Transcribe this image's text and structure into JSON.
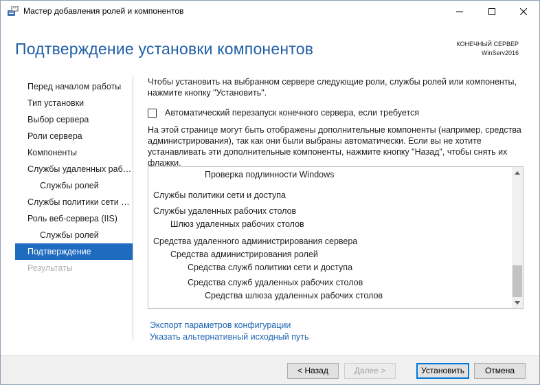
{
  "window": {
    "title": "Мастер добавления ролей и компонентов",
    "controls": {
      "minimize": "—",
      "maximize": "☐",
      "close": "✕"
    },
    "icons": {
      "app": "server-manager-icon"
    }
  },
  "header": {
    "title": "Подтверждение установки компонентов",
    "server_label": "КОНЕЧНЫЙ СЕРВЕР",
    "server_name": "WinServ2016"
  },
  "nav": {
    "items": [
      {
        "label": "Перед началом работы",
        "level": 0,
        "state": "normal"
      },
      {
        "label": "Тип установки",
        "level": 0,
        "state": "normal"
      },
      {
        "label": "Выбор сервера",
        "level": 0,
        "state": "normal"
      },
      {
        "label": "Роли сервера",
        "level": 0,
        "state": "normal"
      },
      {
        "label": "Компоненты",
        "level": 0,
        "state": "normal"
      },
      {
        "label": "Службы удаленных рабо...",
        "level": 0,
        "state": "normal"
      },
      {
        "label": "Службы ролей",
        "level": 1,
        "state": "normal"
      },
      {
        "label": "Службы политики сети и...",
        "level": 0,
        "state": "normal"
      },
      {
        "label": "Роль веб-сервера (IIS)",
        "level": 0,
        "state": "normal"
      },
      {
        "label": "Службы ролей",
        "level": 1,
        "state": "normal"
      },
      {
        "label": "Подтверждение",
        "level": 0,
        "state": "active"
      },
      {
        "label": "Результаты",
        "level": 0,
        "state": "disabled"
      }
    ]
  },
  "content": {
    "intro": "Чтобы установить на выбранном сервере следующие роли, службы ролей или компоненты, нажмите кнопку \"Установить\".",
    "restart_checkbox": "Автоматический перезапуск конечного сервера, если требуется",
    "note": "На этой странице могут быть отображены дополнительные компоненты (например, средства администрирования), так как они были выбраны автоматически. Если вы не хотите устанавливать эти дополнительные компоненты, нажмите кнопку \"Назад\", чтобы снять их флажки.",
    "list": [
      {
        "text": "Проверка подлинности Windows",
        "level": 3
      },
      {
        "text": "Службы политики сети и доступа",
        "level": 0
      },
      {
        "text": "Службы удаленных рабочих столов",
        "level": 0
      },
      {
        "text": "Шлюз удаленных рабочих столов",
        "level": 1
      },
      {
        "text": "Средства удаленного администрирования сервера",
        "level": 0
      },
      {
        "text": "Средства администрирования ролей",
        "level": 1
      },
      {
        "text": "Средства служб политики сети и доступа",
        "level": 2
      },
      {
        "text": "Средства служб удаленных рабочих столов",
        "level": 2
      },
      {
        "text": "Средства шлюза удаленных рабочих столов",
        "level": 3
      }
    ],
    "links": {
      "export": "Экспорт параметров конфигурации",
      "alt_source": "Указать альтернативный исходный путь"
    }
  },
  "footer": {
    "back": "< Назад",
    "next": "Далее >",
    "install": "Установить",
    "cancel": "Отмена"
  },
  "colors": {
    "accent": "#1e6bbf",
    "title": "#1e5ea5",
    "link": "#1e64b4"
  }
}
